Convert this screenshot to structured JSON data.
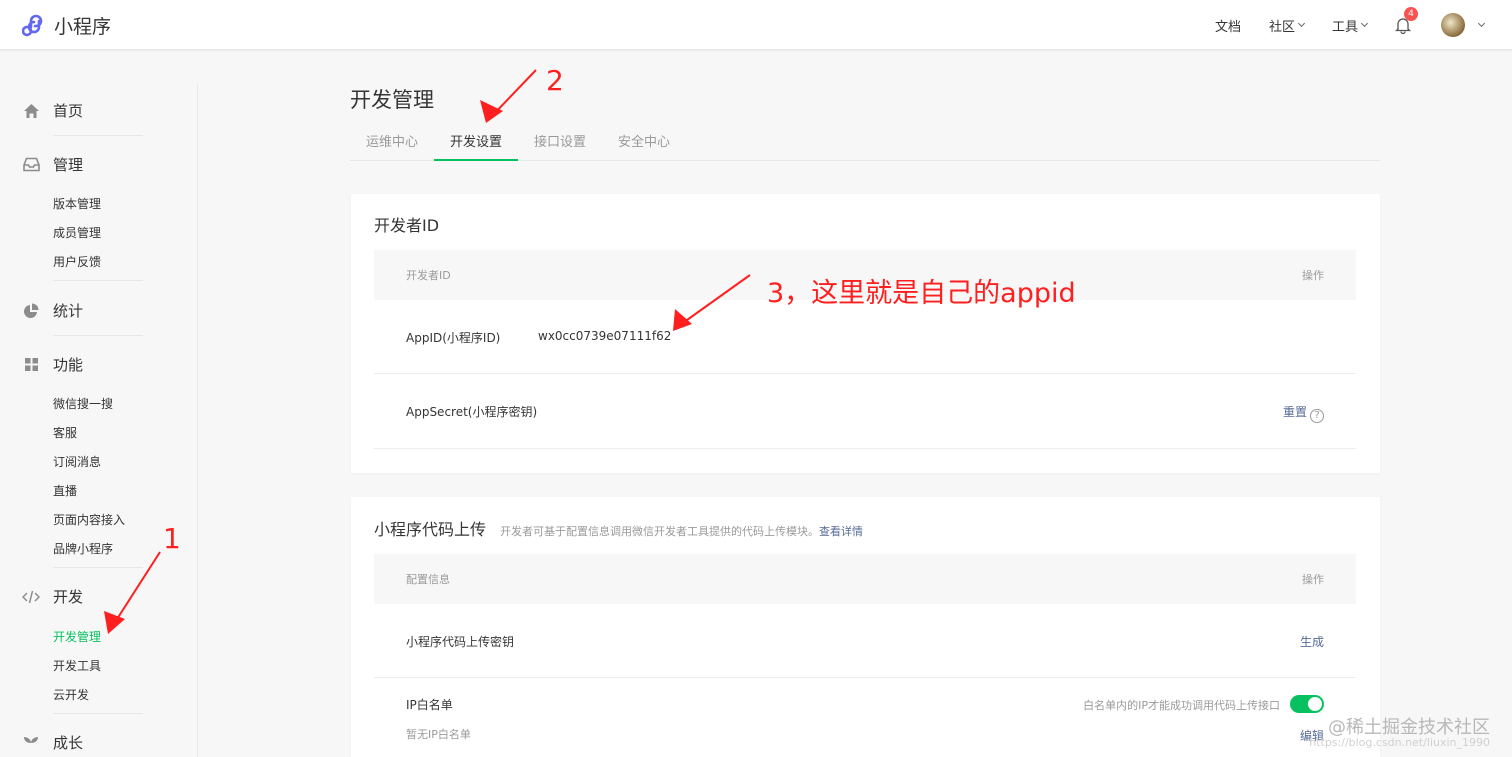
{
  "app": {
    "title": "小程序"
  },
  "topnav": {
    "docs": "文档",
    "community": "社区",
    "tools": "工具",
    "notification_count": "4"
  },
  "sidebar": {
    "home": "首页",
    "manage": {
      "label": "管理",
      "items": [
        "版本管理",
        "成员管理",
        "用户反馈"
      ]
    },
    "stats": "统计",
    "features": {
      "label": "功能",
      "items": [
        "微信搜一搜",
        "客服",
        "订阅消息",
        "直播",
        "页面内容接入",
        "品牌小程序"
      ]
    },
    "dev": {
      "label": "开发",
      "items": [
        "开发管理",
        "开发工具",
        "云开发"
      ]
    },
    "growth": "成长"
  },
  "page": {
    "title": "开发管理"
  },
  "tabs": [
    "运维中心",
    "开发设置",
    "接口设置",
    "安全中心"
  ],
  "developer_id": {
    "title": "开发者ID",
    "col_left": "开发者ID",
    "col_right": "操作",
    "appid_label": "AppID(小程序ID)",
    "appid_value": "wx0cc0739e07111f62",
    "secret_label": "AppSecret(小程序密钥)",
    "secret_action": "重置"
  },
  "code_upload": {
    "title": "小程序代码上传",
    "desc": "开发者可基于配置信息调用微信开发者工具提供的代码上传模块。",
    "desc_link": "查看详情",
    "col_left": "配置信息",
    "col_right": "操作",
    "key_label": "小程序代码上传密钥",
    "key_action": "生成",
    "ip_label": "IP白名单",
    "ip_hint": "白名单内的IP才能成功调用代码上传接口",
    "ip_empty": "暂无IP白名单",
    "ip_action": "编辑"
  },
  "annotations": {
    "one": "1",
    "two": "2",
    "three": "3，这里就是自己的appid"
  },
  "watermark": {
    "text": "@稀土掘金技术社区",
    "url": "https://blog.csdn.net/liuxin_1990"
  },
  "colors": {
    "accent": "#07c160",
    "link": "#576b95",
    "annotation": "#ff1f1f",
    "badge": "#fa5151"
  }
}
